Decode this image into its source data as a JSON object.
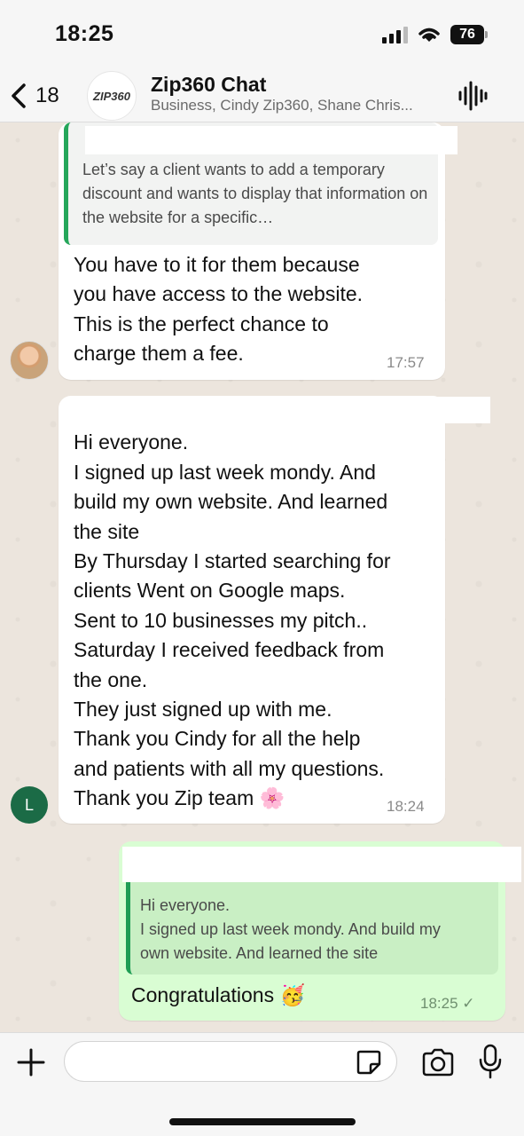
{
  "status_bar": {
    "time": "18:25",
    "battery": "76"
  },
  "header": {
    "back_count": "18",
    "avatar_logo": "ZIP360",
    "title": "Zip360 Chat",
    "subtitle": "Business, Cindy Zip360, Shane Chris..."
  },
  "messages": [
    {
      "quote": "Let’s say a client wants to add a temporary discount and wants to display that information on the website for a specific…",
      "lines": [
        "You have to  it for them because",
        "you have access to the website.",
        "This is the perfect chance to",
        "charge them a fee."
      ],
      "time": "17:57"
    },
    {
      "lines": [
        "Hi everyone.",
        "I signed up last week mondy. And",
        "build my own website. And learned",
        "the site",
        "By Thursday I started searching for",
        "clients Went on Google maps.",
        "Sent to 10 businesses my pitch..",
        "Saturday I received feedback from",
        "the one.",
        "They just signed up with me.",
        "Thank you Cindy for all the help",
        "and patients with all my questions.",
        "Thank you Zip team 🌸"
      ],
      "time": "18:24",
      "avatar_letter": "L"
    },
    {
      "quote_lines": [
        "Hi everyone.",
        "I signed up last week mondy. And build my",
        "own website. And learned the site"
      ],
      "text": "Congratulations 🥳",
      "time": "18:25 ✓"
    }
  ],
  "icons": [
    "chevron-left-icon",
    "waveform-icon",
    "plus-icon",
    "sticker-icon",
    "camera-icon",
    "microphone-icon"
  ],
  "colors": {
    "outgoing_bubble": "#d9fdd3",
    "quote_bar": "#25a65a",
    "avatar_l": "#1b6b46"
  }
}
